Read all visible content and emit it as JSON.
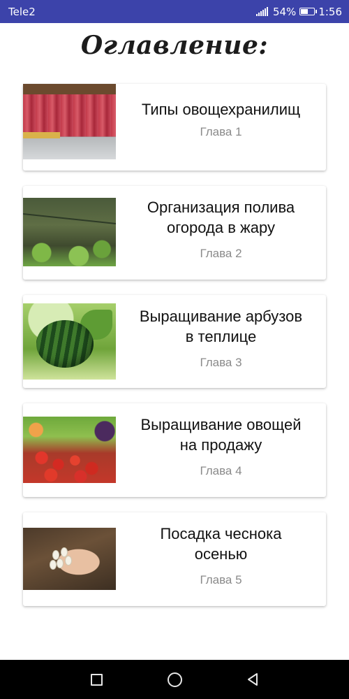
{
  "status_bar": {
    "carrier": "Tele2",
    "battery": "54%",
    "time": "1:56",
    "battery_level": 0.54
  },
  "page": {
    "title": "Оглавление:"
  },
  "chapters": [
    {
      "title_line1": "Типы овощехранилищ",
      "title_line2": "",
      "chapter": "Глава 1",
      "image": "warehouse-photo"
    },
    {
      "title_line1": "Организация полива",
      "title_line2": "огорода в жару",
      "chapter": "Глава 2",
      "image": "garden-watering-photo"
    },
    {
      "title_line1": "Выращивание арбузов",
      "title_line2": "в теплице",
      "chapter": "Глава 3",
      "image": "watermelon-photo"
    },
    {
      "title_line1": "Выращивание овощей",
      "title_line2": "на продажу",
      "chapter": "Глава 4",
      "image": "vegetables-photo"
    },
    {
      "title_line1": "Посадка чеснока",
      "title_line2": "осенью",
      "chapter": "Глава 5",
      "image": "garlic-photo"
    }
  ],
  "nav_bar": {
    "icons": [
      "recents-square-icon",
      "home-circle-icon",
      "back-triangle-icon"
    ]
  },
  "colors": {
    "status_bar": "#3c43aa",
    "nav_bar": "#000000",
    "title_text": "#111111",
    "chapter_text": "#8a8a8a"
  }
}
